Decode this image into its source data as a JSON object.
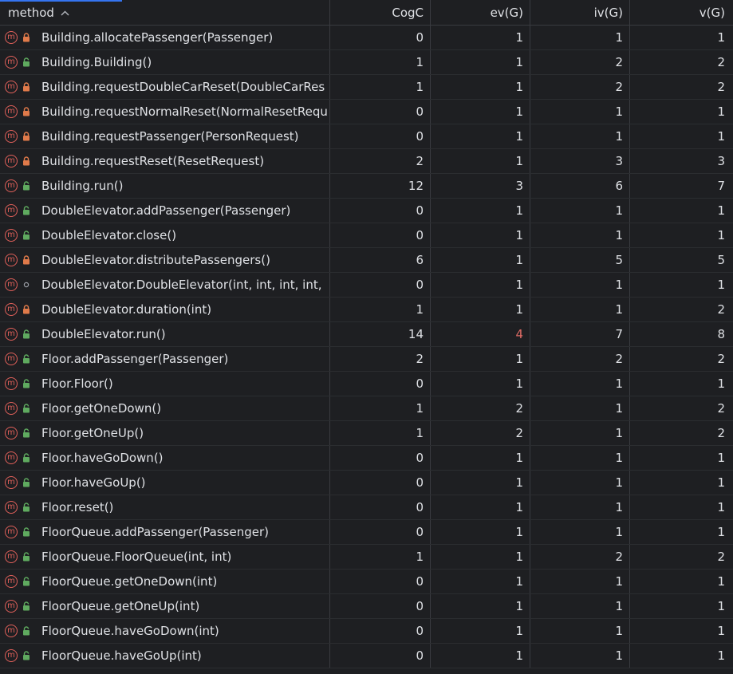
{
  "columns": {
    "method": "method",
    "cogc": "CogC",
    "ev": "ev(G)",
    "iv": "iv(G)",
    "v": "v(G)"
  },
  "colors": {
    "method_icon": "#e0605a",
    "private_lock": "#e07a4a",
    "public_unlock": "#5faa5f",
    "package_dot": "#9da0a8",
    "highlight_value": "#e06c66"
  },
  "rows": [
    {
      "method": "Building.allocatePassenger(Passenger)",
      "visibility": "private",
      "cogc": "0",
      "ev": "1",
      "iv": "1",
      "v": "1"
    },
    {
      "method": "Building.Building()",
      "visibility": "public",
      "cogc": "1",
      "ev": "1",
      "iv": "2",
      "v": "2"
    },
    {
      "method": "Building.requestDoubleCarReset(DoubleCarRes",
      "visibility": "private",
      "cogc": "1",
      "ev": "1",
      "iv": "2",
      "v": "2"
    },
    {
      "method": "Building.requestNormalReset(NormalResetRequ",
      "visibility": "private",
      "cogc": "0",
      "ev": "1",
      "iv": "1",
      "v": "1"
    },
    {
      "method": "Building.requestPassenger(PersonRequest)",
      "visibility": "private",
      "cogc": "0",
      "ev": "1",
      "iv": "1",
      "v": "1"
    },
    {
      "method": "Building.requestReset(ResetRequest)",
      "visibility": "private",
      "cogc": "2",
      "ev": "1",
      "iv": "3",
      "v": "3"
    },
    {
      "method": "Building.run()",
      "visibility": "public",
      "cogc": "12",
      "ev": "3",
      "iv": "6",
      "v": "7"
    },
    {
      "method": "DoubleElevator.addPassenger(Passenger)",
      "visibility": "public",
      "cogc": "0",
      "ev": "1",
      "iv": "1",
      "v": "1"
    },
    {
      "method": "DoubleElevator.close()",
      "visibility": "public",
      "cogc": "0",
      "ev": "1",
      "iv": "1",
      "v": "1"
    },
    {
      "method": "DoubleElevator.distributePassengers()",
      "visibility": "private",
      "cogc": "6",
      "ev": "1",
      "iv": "5",
      "v": "5"
    },
    {
      "method": "DoubleElevator.DoubleElevator(int, int, int, int,",
      "visibility": "package",
      "cogc": "0",
      "ev": "1",
      "iv": "1",
      "v": "1"
    },
    {
      "method": "DoubleElevator.duration(int)",
      "visibility": "private",
      "cogc": "1",
      "ev": "1",
      "iv": "1",
      "v": "2"
    },
    {
      "method": "DoubleElevator.run()",
      "visibility": "public",
      "cogc": "14",
      "ev": "4",
      "iv": "7",
      "v": "8",
      "ev_highlight": true
    },
    {
      "method": "Floor.addPassenger(Passenger)",
      "visibility": "public",
      "cogc": "2",
      "ev": "1",
      "iv": "2",
      "v": "2"
    },
    {
      "method": "Floor.Floor()",
      "visibility": "public",
      "cogc": "0",
      "ev": "1",
      "iv": "1",
      "v": "1"
    },
    {
      "method": "Floor.getOneDown()",
      "visibility": "public",
      "cogc": "1",
      "ev": "2",
      "iv": "1",
      "v": "2"
    },
    {
      "method": "Floor.getOneUp()",
      "visibility": "public",
      "cogc": "1",
      "ev": "2",
      "iv": "1",
      "v": "2"
    },
    {
      "method": "Floor.haveGoDown()",
      "visibility": "public",
      "cogc": "0",
      "ev": "1",
      "iv": "1",
      "v": "1"
    },
    {
      "method": "Floor.haveGoUp()",
      "visibility": "public",
      "cogc": "0",
      "ev": "1",
      "iv": "1",
      "v": "1"
    },
    {
      "method": "Floor.reset()",
      "visibility": "public",
      "cogc": "0",
      "ev": "1",
      "iv": "1",
      "v": "1"
    },
    {
      "method": "FloorQueue.addPassenger(Passenger)",
      "visibility": "public",
      "cogc": "0",
      "ev": "1",
      "iv": "1",
      "v": "1"
    },
    {
      "method": "FloorQueue.FloorQueue(int, int)",
      "visibility": "public",
      "cogc": "1",
      "ev": "1",
      "iv": "2",
      "v": "2"
    },
    {
      "method": "FloorQueue.getOneDown(int)",
      "visibility": "public",
      "cogc": "0",
      "ev": "1",
      "iv": "1",
      "v": "1"
    },
    {
      "method": "FloorQueue.getOneUp(int)",
      "visibility": "public",
      "cogc": "0",
      "ev": "1",
      "iv": "1",
      "v": "1"
    },
    {
      "method": "FloorQueue.haveGoDown(int)",
      "visibility": "public",
      "cogc": "0",
      "ev": "1",
      "iv": "1",
      "v": "1"
    },
    {
      "method": "FloorQueue.haveGoUp(int)",
      "visibility": "public",
      "cogc": "0",
      "ev": "1",
      "iv": "1",
      "v": "1"
    }
  ]
}
